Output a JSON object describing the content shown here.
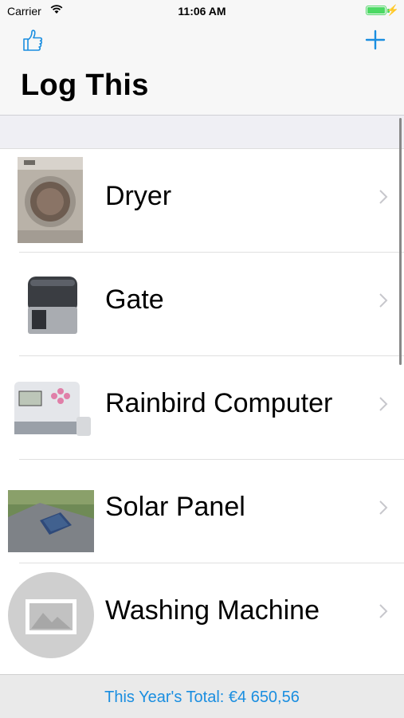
{
  "status_bar": {
    "carrier": "Carrier",
    "time": "11:06 AM",
    "wifi_icon": "wifi-icon",
    "battery_icon": "battery-icon",
    "charging_icon": "bolt-icon"
  },
  "navbar": {
    "title": "Log This",
    "left_icon": "thumbs-up-icon",
    "right_icon": "plus-icon",
    "accent_color": "#1a8ee0"
  },
  "items": [
    {
      "label": "Dryer",
      "image": "dryer-photo"
    },
    {
      "label": "Gate",
      "image": "gate-motor-photo"
    },
    {
      "label": "Rainbird Computer",
      "image": "irrigation-controller-photo"
    },
    {
      "label": "Solar Panel",
      "image": "solar-panel-photo"
    },
    {
      "label": "Washing Machine",
      "image": "placeholder-image-icon"
    }
  ],
  "footer": {
    "total_text": "This Year's Total: €4 650,56"
  }
}
